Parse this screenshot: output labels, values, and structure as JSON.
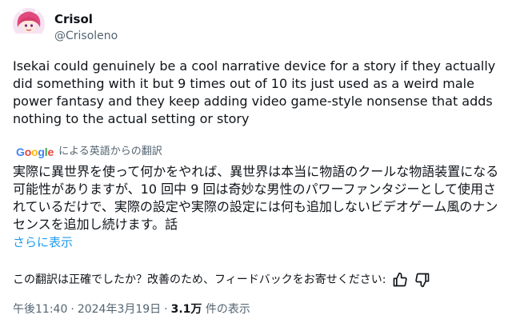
{
  "author": {
    "name": "Crisol",
    "handle": "@Crisoleno"
  },
  "tweet": {
    "text": "Isekai could genuinely be a cool narrative device for a story if they actually did something with it but 9 times out of 10 its just used as a weird male power fantasy and they keep adding video game-style nonsense that adds nothing to the actual setting or story"
  },
  "translation": {
    "provider": "Google",
    "label": "による英語からの翻訳",
    "text": "実際に異世界を使って何かをやれば、異世界は本当に物語のクールな物語装置になる可能性がありますが、10 回中 9 回は奇妙な男性のパワーファンタジーとして使用されているだけで、実際の設定や実際の設定には何も追加しないビデオゲーム風のナンセンスを追加し続けます。話",
    "show_more": "さらに表示",
    "feedback_question": "この翻訳は正確でしたか？改善のため、フィードバックをお寄せください:"
  },
  "meta": {
    "time": "午後11:40",
    "date": "2024年3月19日",
    "separator": "·",
    "views_count": "3.1万",
    "views_label": "件の表示"
  },
  "icons": {
    "thumbs_up": "thumbs-up-icon",
    "thumbs_down": "thumbs-down-icon"
  }
}
